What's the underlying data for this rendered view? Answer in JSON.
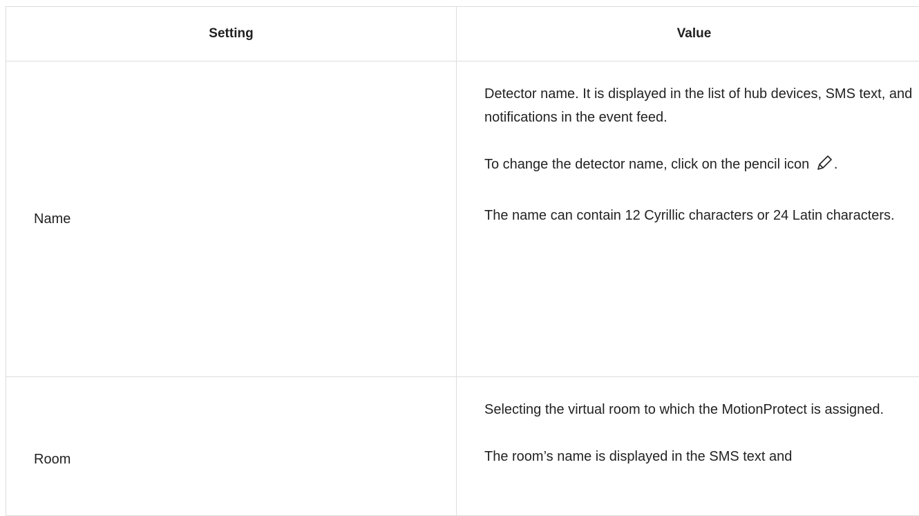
{
  "table": {
    "header": {
      "setting": "Setting",
      "value": "Value"
    },
    "rows": [
      {
        "setting": "Name",
        "paragraphs": [
          "Detector name. It is displayed in the list of hub devices, SMS text, and notifications in the event feed.",
          "To change the detector name, click on the pencil icon",
          "The name can contain 12 Cyrillic characters or 24 Latin characters."
        ],
        "icon": "pencil-icon",
        "after_icon": "."
      },
      {
        "setting": "Room",
        "paragraphs": [
          "Selecting the virtual room to which the MotionProtect is assigned.",
          "The room’s name is displayed in the SMS text and"
        ]
      }
    ]
  }
}
